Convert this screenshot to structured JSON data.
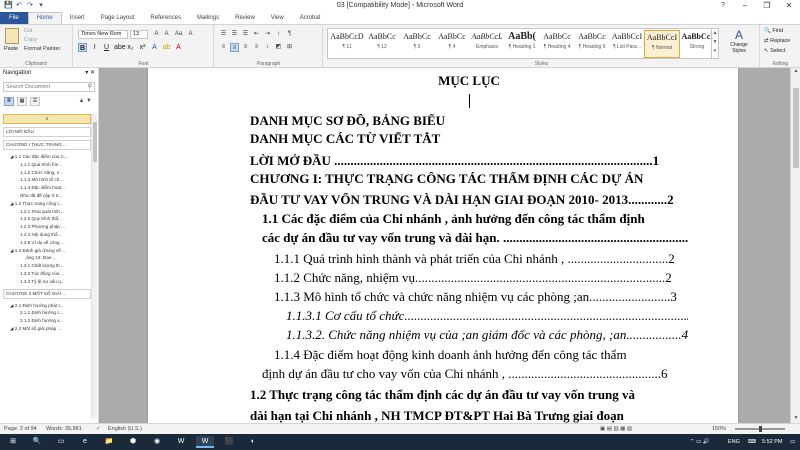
{
  "window": {
    "title": "03 [Compatibility Mode] - Microsoft Word",
    "controls": {
      "help": "?",
      "minimize": "–",
      "restore": "❐",
      "close": "✕"
    },
    "qat": [
      "💾",
      "↶",
      "↷",
      "▾"
    ]
  },
  "tabs": [
    "File",
    "Home",
    "Insert",
    "Page Layout",
    "References",
    "Mailings",
    "Review",
    "View",
    "Acrobat"
  ],
  "ribbon": {
    "clipboard": {
      "paste": "Paste",
      "cut": "Cut",
      "copy": "Copy",
      "format_painter": "Format Painter",
      "label": "Clipboard"
    },
    "font": {
      "name": "Times New Rom",
      "size": "13",
      "label": "Font",
      "buttons": [
        "B",
        "I",
        "U",
        "abe",
        "x₂",
        "x²",
        "A",
        "ab",
        "A"
      ]
    },
    "paragraph": {
      "label": "Paragraph",
      "buttons": [
        "≡",
        "≡",
        "≡",
        "≡",
        "↕",
        "◩",
        "⊞",
        "☰",
        "☰",
        "☰",
        "⇤",
        "⇥",
        "↕",
        "¶"
      ]
    },
    "styles": {
      "label": "Styles",
      "tiles": [
        {
          "preview": "AaBbCcD",
          "name": "¶ 11"
        },
        {
          "preview": "AaBbCc",
          "name": "¶ 12"
        },
        {
          "preview": "AaBbCc",
          "name": "¶ 3"
        },
        {
          "preview": "AaBbCc",
          "name": "¶ 4"
        },
        {
          "preview": "AaBbCcL",
          "name": "Emphasis"
        },
        {
          "preview": "AaBb(",
          "name": "¶ Heading 1"
        },
        {
          "preview": "AaBbCc",
          "name": "¶ Heading 4"
        },
        {
          "preview": "AaBbCc",
          "name": "¶ Heading 9"
        },
        {
          "preview": "AaBbCcI",
          "name": "¶ List Para..."
        },
        {
          "preview": "AaBbCcI",
          "name": "¶ Normal"
        },
        {
          "preview": "AaBbCcl",
          "name": "Strong"
        }
      ],
      "change_styles": "Change Styles"
    },
    "editing": {
      "find": "Find",
      "replace": "Replace",
      "select": "Select",
      "label": "Editing"
    }
  },
  "nav": {
    "title": "Navigation",
    "search_placeholder": "Search Document",
    "items": [
      {
        "text": "LỜI MỞ ĐẦU",
        "indent": 0,
        "style": "boxed"
      },
      {
        "text": "CHƯƠNG I THỰC TRẠNG ...",
        "indent": 0,
        "style": "boxed"
      },
      {
        "text": "◢ 1.1 Các đặc điểm của C...",
        "indent": 1
      },
      {
        "text": "1.1.1 Quá trình hìn...",
        "indent": 3
      },
      {
        "text": "1.1.2 Chức năng, n...",
        "indent": 3
      },
      {
        "text": "1.1.3 Mô hình tổ ch...",
        "indent": 3
      },
      {
        "text": "1.1.4 Đặc điểm hoạt...",
        "indent": 3
      },
      {
        "text": "Như đã đề cập ở tr...",
        "indent": 3
      },
      {
        "text": "◢ 1.2 Thực trạng công t...",
        "indent": 1
      },
      {
        "text": "1.2.1 Khái quát tình...",
        "indent": 3
      },
      {
        "text": "1.2.2 Quy trình thẩ...",
        "indent": 3
      },
      {
        "text": "1.2.3 Phương pháp ...",
        "indent": 3
      },
      {
        "text": "1.2.4 Nội dung thẩ...",
        "indent": 3
      },
      {
        "text": "1.2.5 Ví dụ về công ...",
        "indent": 3
      },
      {
        "text": "◢ 1.3 Đánh giá chung về ...",
        "indent": 1
      },
      {
        "text": ",ảng 13: Đan...",
        "indent": 4
      },
      {
        "text": "1.3.1 Chất lượng th...",
        "indent": 3
      },
      {
        "text": "1.3.2 Tác động của ...",
        "indent": 3
      },
      {
        "text": "1.3.3 Tỷ lệ nợ xấu q...",
        "indent": 3
      },
      {
        "text": "CHƯƠNG II MỘT SỐ GIẢI ...",
        "indent": 0,
        "style": "boxed"
      },
      {
        "text": "◢ 2.1 Định hướng phát t...",
        "indent": 1
      },
      {
        "text": "2.1.1 Định hướng c...",
        "indent": 3
      },
      {
        "text": "2.1.2 Định hướng v...",
        "indent": 3
      },
      {
        "text": "◢ 2.2 Một số giải pháp ...",
        "indent": 1
      }
    ]
  },
  "document": {
    "heading": "MỤC LỤC",
    "lines": [
      {
        "text": "DANH MỤC SƠ ĐỒ, BẢNG BIỂU",
        "style": "bold",
        "indent": 0
      },
      {
        "text": "DANH MỤC CÁC TỪ VIẾT TẮT",
        "style": "bold",
        "indent": 0
      },
      {
        "text": "LỜI MỞ ĐẦU ..................................................................................................1",
        "style": "bold",
        "indent": 0
      },
      {
        "text": "CHƯƠNG I: THỰC TRẠNG CÔNG TÁC  THẨM ĐỊNH CÁC DỰ ÁN",
        "style": "bold",
        "indent": 0
      },
      {
        "text": "ĐẦU TƯ VAY VỐN TRUNG VÀ DÀI HẠN GIAI ĐOẠN  2010- 2013............2",
        "style": "bold",
        "indent": 0
      },
      {
        "text": "1.1 Các đặc điểm của Chi nhánh , ảnh hưởng đến công tác thẩm định",
        "style": "bold",
        "indent": 12
      },
      {
        "text": "các dự án đầu tư vay vốn trung và dài hạn. ...........................................................2",
        "style": "bold",
        "indent": 12
      },
      {
        "text": "1.1.1  Quá trình hình thành và phát triển của Chi nhánh , ...............................2",
        "style": "",
        "indent": 24
      },
      {
        "text": "1.1.2  Chức năng, nhiệm vụ.............................................................................2",
        "style": "",
        "indent": 24
      },
      {
        "text": "1.1.3  Mô hình tổ chức và chức năng nhiệm vụ các phòng ;an.........................3",
        "style": "",
        "indent": 24
      },
      {
        "text": "1.1.3.1 Cơ cấu tổ chức.......................................................................................3",
        "style": "italic",
        "indent": 36
      },
      {
        "text": "1.1.3.2. Chức năng nhiệm vụ của ;an giám đốc và các phòng, ;an.................4",
        "style": "italic",
        "indent": 36
      },
      {
        "text": "1.1.4       Đặc điểm hoạt động kinh doanh ảnh hưởng đến công tác thẩm",
        "style": "",
        "indent": 24
      },
      {
        "text": "định dự án đầu tư cho vay vốn của Chi nhánh , ...............................................6",
        "style": "",
        "indent": 12
      },
      {
        "text": "1.2 Thực trạng công tác thẩm định các dự án đầu tư vay vốn trung và",
        "style": "bold",
        "indent": 0
      },
      {
        "text": "dài hạn tại Chi nhánh , NH TMCP ĐT&PT Hai Bà Trưng giai đoạn",
        "style": "bold",
        "indent": 0
      }
    ]
  },
  "status": {
    "page": "Page: 2 of 94",
    "words": "Words: 39,981",
    "language": "English (U.S.)",
    "zoom": "150%",
    "zoom_fraction": 0.5
  },
  "taskbar": {
    "items": [
      "⊞",
      "🔍",
      "▭",
      "e",
      "📁",
      "⬢",
      "◉",
      "W",
      "W",
      "⬛",
      "◐"
    ],
    "active_index": 8,
    "tray_lang": "ENG",
    "time": "5:52 PM"
  }
}
